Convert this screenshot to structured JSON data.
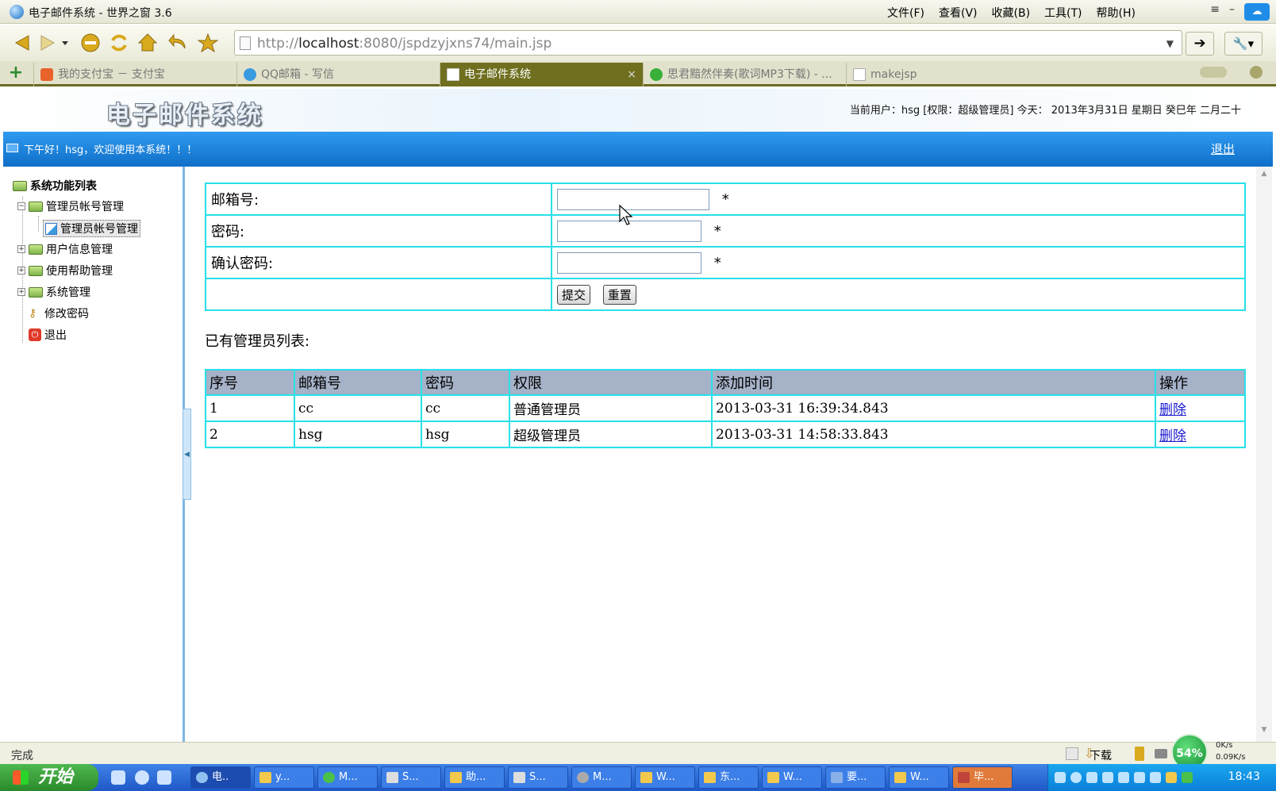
{
  "window": {
    "title": "电子邮件系统 - 世界之窗 3.6",
    "menus": [
      "文件(F)",
      "查看(V)",
      "收藏(B)",
      "工具(T)",
      "帮助(H)"
    ],
    "cloud_label": "☁"
  },
  "address_bar": {
    "url_prefix": "http://",
    "url_host": "localhost",
    "url_rest": ":8080/jspdzyjxns74/main.jsp"
  },
  "tabs": [
    {
      "label": "我的支付宝 － 支付宝",
      "icon_color": "#e8622a",
      "active": false
    },
    {
      "label": "QQ邮箱 - 写信",
      "icon_color": "#3a9ae0",
      "active": false
    },
    {
      "label": "电子邮件系统",
      "icon_color": "#ffffff",
      "active": true
    },
    {
      "label": "思君黯然伴奏(歌词MP3下载) - ...",
      "icon_color": "#38b03a",
      "active": false
    },
    {
      "label": "makejsp",
      "icon_color": "#ffffff",
      "active": false
    }
  ],
  "header": {
    "system_title": "电子邮件系统",
    "user_info": "当前用户：hsg [权限：超级管理员] 今天： 2013年3月31日 星期日 癸巳年 二月二十"
  },
  "bluebar": {
    "greeting": "下午好！hsg，欢迎使用本系统！！！",
    "logout": "退出"
  },
  "sidebar": {
    "root": "系统功能列表",
    "items": [
      {
        "label": "管理员帐号管理",
        "expander": "⊟"
      },
      {
        "label": "管理员帐号管理"
      },
      {
        "label": "用户信息管理",
        "expander": "⊞"
      },
      {
        "label": "使用帮助管理",
        "expander": "⊞"
      },
      {
        "label": "系统管理",
        "expander": "⊞"
      },
      {
        "label": "修改密码"
      },
      {
        "label": "退出"
      }
    ]
  },
  "form": {
    "email_label": "邮箱号:",
    "password_label": "密码:",
    "confirm_label": "确认密码:",
    "required_mark": "*",
    "email_value": "",
    "password_value": "",
    "confirm_value": "",
    "submit_label": "提交",
    "reset_label": "重置"
  },
  "list": {
    "title": "已有管理员列表:",
    "columns": [
      "序号",
      "邮箱号",
      "密码",
      "权限",
      "添加时间",
      "操作"
    ],
    "rows": [
      [
        "1",
        "cc",
        "cc",
        "普通管理员",
        "2013-03-31 16:39:34.843",
        "删除"
      ],
      [
        "2",
        "hsg",
        "hsg",
        "超级管理员",
        "2013-03-31 14:58:33.843",
        "删除"
      ]
    ]
  },
  "statusbar": {
    "status": "完成",
    "download": "下载",
    "percent": "54%",
    "up_speed": "0K/s",
    "down_speed": "0.09K/s"
  },
  "taskbar": {
    "start": "开始",
    "tasks": [
      "电..",
      "y...",
      "M...",
      "S...",
      "助...",
      "S...",
      "M...",
      "W...",
      "东...",
      "W...",
      "要...",
      "W...",
      "毕..."
    ],
    "clock": "18:43"
  }
}
